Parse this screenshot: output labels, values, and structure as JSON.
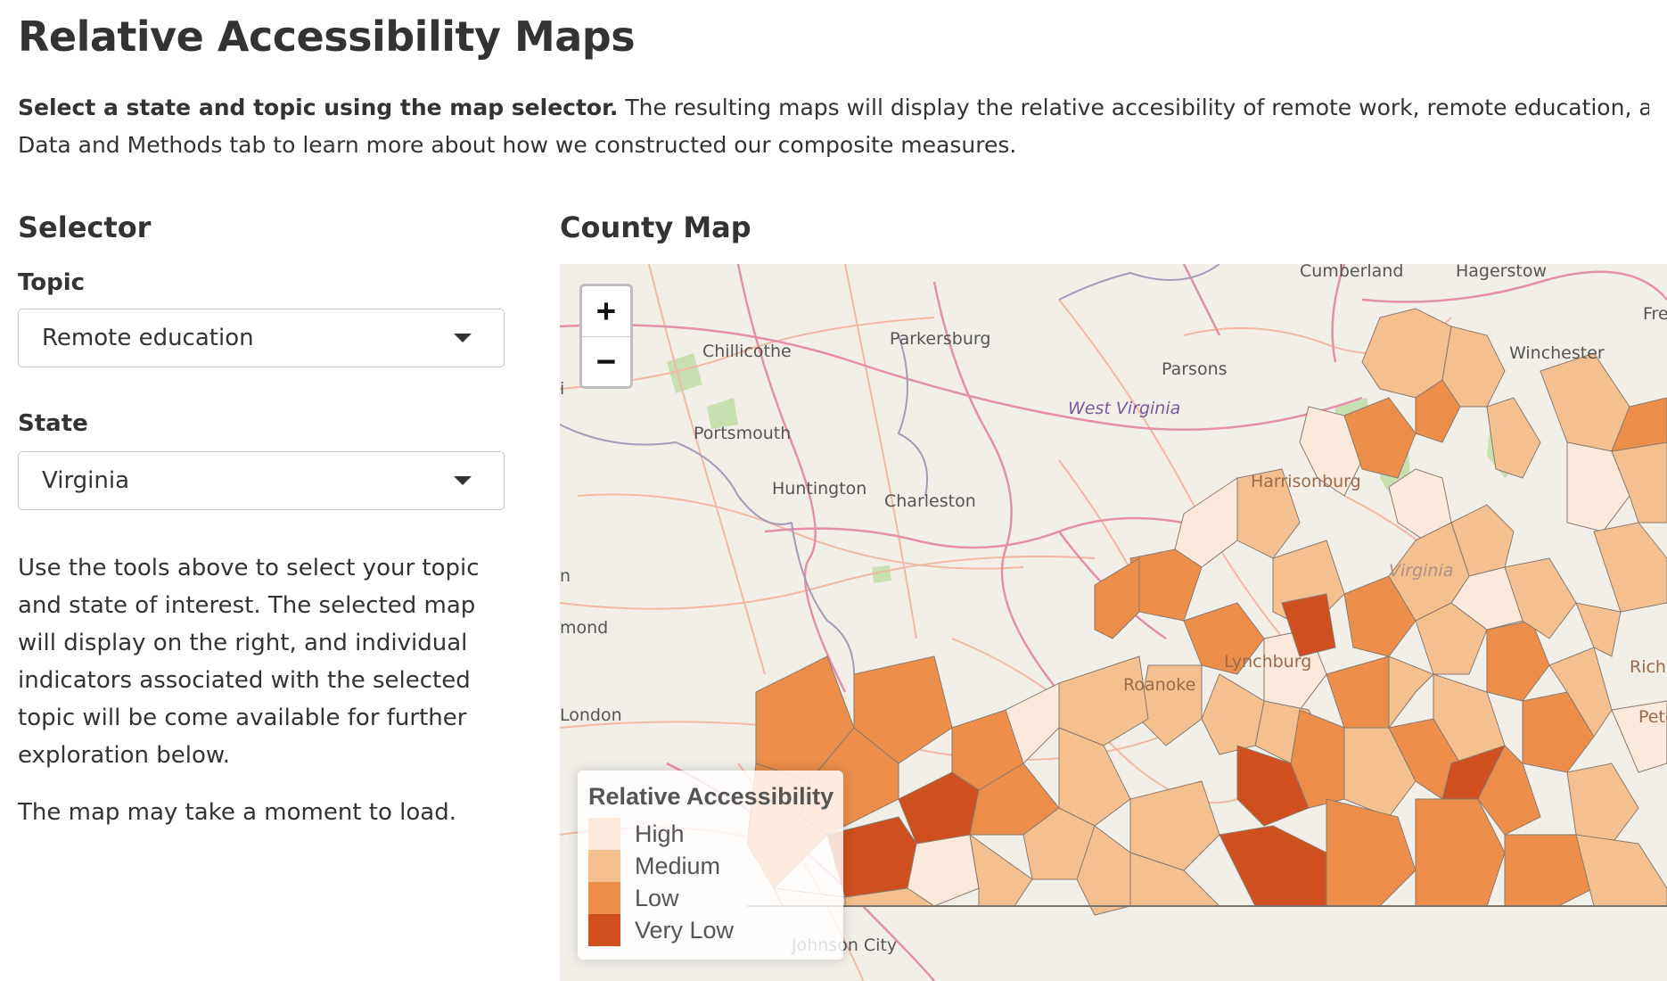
{
  "page": {
    "title": "Relative Accessibility Maps",
    "intro_bold": "Select a state and topic using the map selector.",
    "intro_rest": " The resulting maps will display the relative accesibility of remote work, remote education, and teler",
    "intro_line2": "Data and Methods tab to learn more about how we constructed our composite measures."
  },
  "selector": {
    "heading": "Selector",
    "topic_label": "Topic",
    "topic_value": "Remote education",
    "state_label": "State",
    "state_value": "Virginia",
    "help_text": "Use the tools above to select your topic and state of interest. The selected map will display on the right, and individual indicators associated with the selected topic will be come available for further exploration below.",
    "load_note": "The map may take a moment to load."
  },
  "map": {
    "heading": "County Map",
    "zoom_in_label": "+",
    "zoom_out_label": "−",
    "place_labels": [
      "Cumberland",
      "Hagerstow",
      "Fre",
      "Chillicothe",
      "Parkersburg",
      "Parsons",
      "Winchester",
      "West Virginia",
      "Portsmouth",
      "Huntington",
      "Charleston",
      "Harrisonburg",
      "Virginia",
      "Lynchburg",
      "Roanoke",
      "Rich",
      "Pete",
      "mond",
      "n",
      "i",
      "London",
      "Johnson City"
    ],
    "legend": {
      "title": "Relative Accessibility",
      "items": [
        {
          "label": "High",
          "color": "#fbe9dc"
        },
        {
          "label": "Medium",
          "color": "#f4c08f"
        },
        {
          "label": "Low",
          "color": "#ec8e4a"
        },
        {
          "label": "Very Low",
          "color": "#cf4f1f"
        }
      ]
    }
  }
}
